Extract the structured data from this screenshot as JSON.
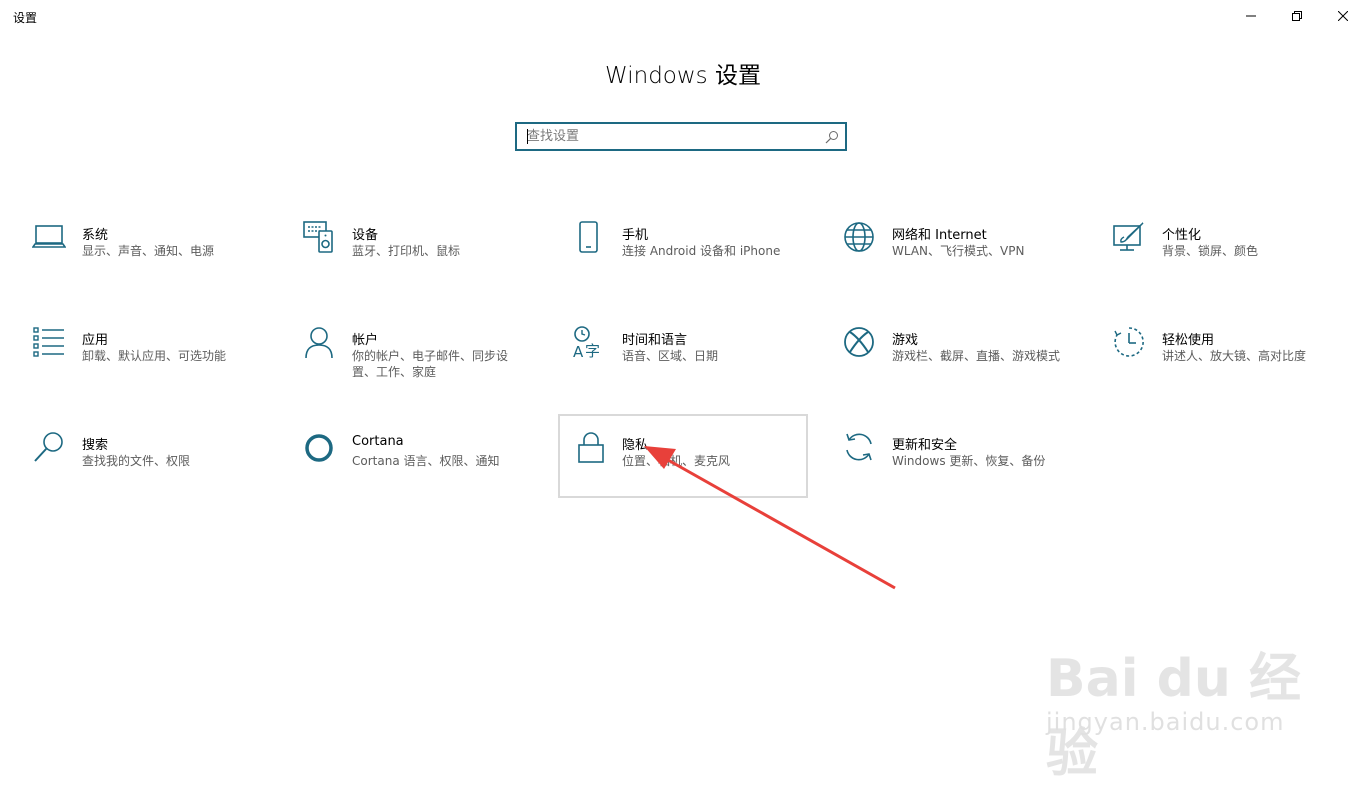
{
  "window": {
    "title": "设置"
  },
  "header": {
    "title": "Windows 设置"
  },
  "search": {
    "placeholder": "查找设置"
  },
  "tiles": [
    {
      "name": "系统",
      "desc": "显示、声音、通知、电源",
      "icon": "laptop-icon"
    },
    {
      "name": "设备",
      "desc": "蓝牙、打印机、鼠标",
      "icon": "devices-icon"
    },
    {
      "name": "手机",
      "desc": "连接 Android 设备和 iPhone",
      "icon": "phone-icon"
    },
    {
      "name": "网络和 Internet",
      "desc": "WLAN、飞行模式、VPN",
      "icon": "globe-icon"
    },
    {
      "name": "个性化",
      "desc": "背景、锁屏、颜色",
      "icon": "personalize-icon"
    },
    {
      "name": "应用",
      "desc": "卸载、默认应用、可选功能",
      "icon": "apps-list-icon"
    },
    {
      "name": "帐户",
      "desc": "你的帐户、电子邮件、同步设置、工作、家庭",
      "icon": "person-icon"
    },
    {
      "name": "时间和语言",
      "desc": "语音、区域、日期",
      "icon": "time-language-icon"
    },
    {
      "name": "游戏",
      "desc": "游戏栏、截屏、直播、游戏模式",
      "icon": "xbox-icon"
    },
    {
      "name": "轻松使用",
      "desc": "讲述人、放大镜、高对比度",
      "icon": "ease-of-access-icon"
    },
    {
      "name": "搜索",
      "desc": "查找我的文件、权限",
      "icon": "magnifier-icon"
    },
    {
      "name": "Cortana",
      "desc": "Cortana 语言、权限、通知",
      "icon": "cortana-icon"
    },
    {
      "name": "隐私",
      "desc": "位置、相机、麦克风",
      "icon": "lock-icon"
    },
    {
      "name": "更新和安全",
      "desc": "Windows 更新、恢复、备份",
      "icon": "sync-icon"
    }
  ],
  "colors": {
    "accent": "#1d6982",
    "annotation_arrow": "#e8403a"
  },
  "watermark": {
    "logo": "Bai du 经验",
    "url": "jingyan.baidu.com"
  }
}
